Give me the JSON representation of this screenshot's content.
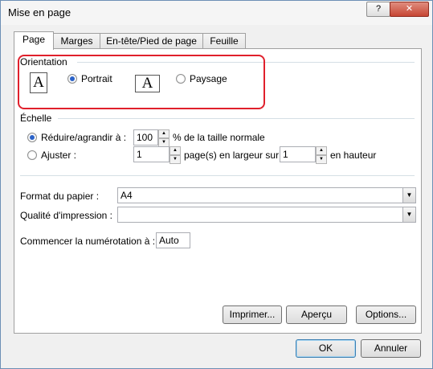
{
  "window": {
    "title": "Mise en page",
    "help_label": "?",
    "close_label": "✕"
  },
  "tabs": [
    "Page",
    "Marges",
    "En-tête/Pied de page",
    "Feuille"
  ],
  "orientation": {
    "group_label": "Orientation",
    "portrait_label": "Portrait",
    "landscape_label": "Paysage",
    "selected": "Portrait",
    "icon_glyph": "A"
  },
  "scale": {
    "group_label": "Échelle",
    "reduce_label": "Réduire/agrandir à :",
    "reduce_value": "100",
    "reduce_suffix": "% de la taille normale",
    "fit_label": "Ajuster :",
    "fit_width_value": "1",
    "fit_width_suffix": "page(s) en largeur sur",
    "fit_height_value": "1",
    "fit_height_suffix": "en hauteur",
    "selected": "reduce"
  },
  "paper": {
    "format_label": "Format du papier :",
    "format_value": "A4",
    "quality_label": "Qualité d'impression :",
    "quality_value": ""
  },
  "numbering": {
    "label": "Commencer la numérotation à :",
    "value": "Auto"
  },
  "panel_buttons": {
    "print": "Imprimer...",
    "preview": "Aperçu",
    "options": "Options..."
  },
  "footer_buttons": {
    "ok": "OK",
    "cancel": "Annuler"
  },
  "colors": {
    "highlight": "#e0202c",
    "radio_dot": "#2a62c8"
  }
}
